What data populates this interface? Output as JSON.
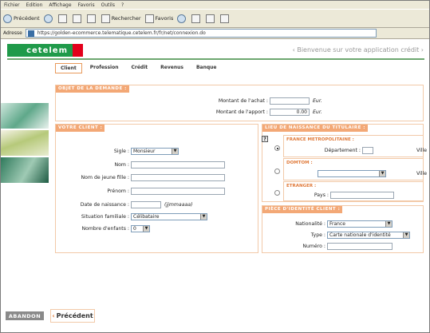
{
  "menu": [
    "Fichier",
    "Edition",
    "Affichage",
    "Favoris",
    "Outils",
    "?"
  ],
  "toolbar": {
    "back": "Précédent",
    "search": "Rechercher",
    "favorites": "Favoris"
  },
  "address": {
    "label": "Adresse",
    "url": "https://golden-ecommerce.telematique.cetelem.fr/fr/net/connexion.do"
  },
  "brand": {
    "logo": "cetelem",
    "welcome": "‹ Bienvenue sur votre application crédit ›"
  },
  "tabs": [
    "Client",
    "Profession",
    "Crédit",
    "Revenus",
    "Banque"
  ],
  "objet": {
    "title": "OBJET DE LA DEMANDE :",
    "achat_label": "Montant de l'achat :",
    "achat_unit": "Eur.",
    "apport_label": "Montant de l'apport :",
    "apport_value": "0.00",
    "apport_unit": "Eur."
  },
  "client": {
    "title": "VOTRE CLIENT :",
    "sigle_label": "Sigle :",
    "sigle_value": "Monsieur",
    "nom_label": "Nom :",
    "jeune_fille_label": "Nom de jeune fille :",
    "prenom_label": "Prénom :",
    "naissance_label": "Date de naissance :",
    "naissance_hint": "(jjmmaaaa)",
    "situation_label": "Situation familiale :",
    "situation_value": "Célibataire",
    "enfants_label": "Nombre d'enfants :",
    "enfants_value": "0"
  },
  "naissance": {
    "title": "LIEU DE NAISSANCE DU TITULAIRE :",
    "help": "?",
    "metro_title": "FRANCE METROPOLITAINE :",
    "dept_label": "Département :",
    "ville_label": "Ville",
    "domtom_title": "DOMTOM :",
    "ville2_label": "Ville",
    "etranger_title": "ETRANGER :",
    "pays_label": "Pays :"
  },
  "identite": {
    "title": "PIÈCE D'IDENTITÉ CLIENT :",
    "nationalite_label": "Nationalité :",
    "nationalite_value": "France",
    "type_label": "Type :",
    "type_value": "Carte nationale d'identité",
    "numero_label": "Numéro :"
  },
  "footer": {
    "abandon": "ABANDON",
    "prev": "Précédent",
    "prev_arrow": "‹"
  }
}
